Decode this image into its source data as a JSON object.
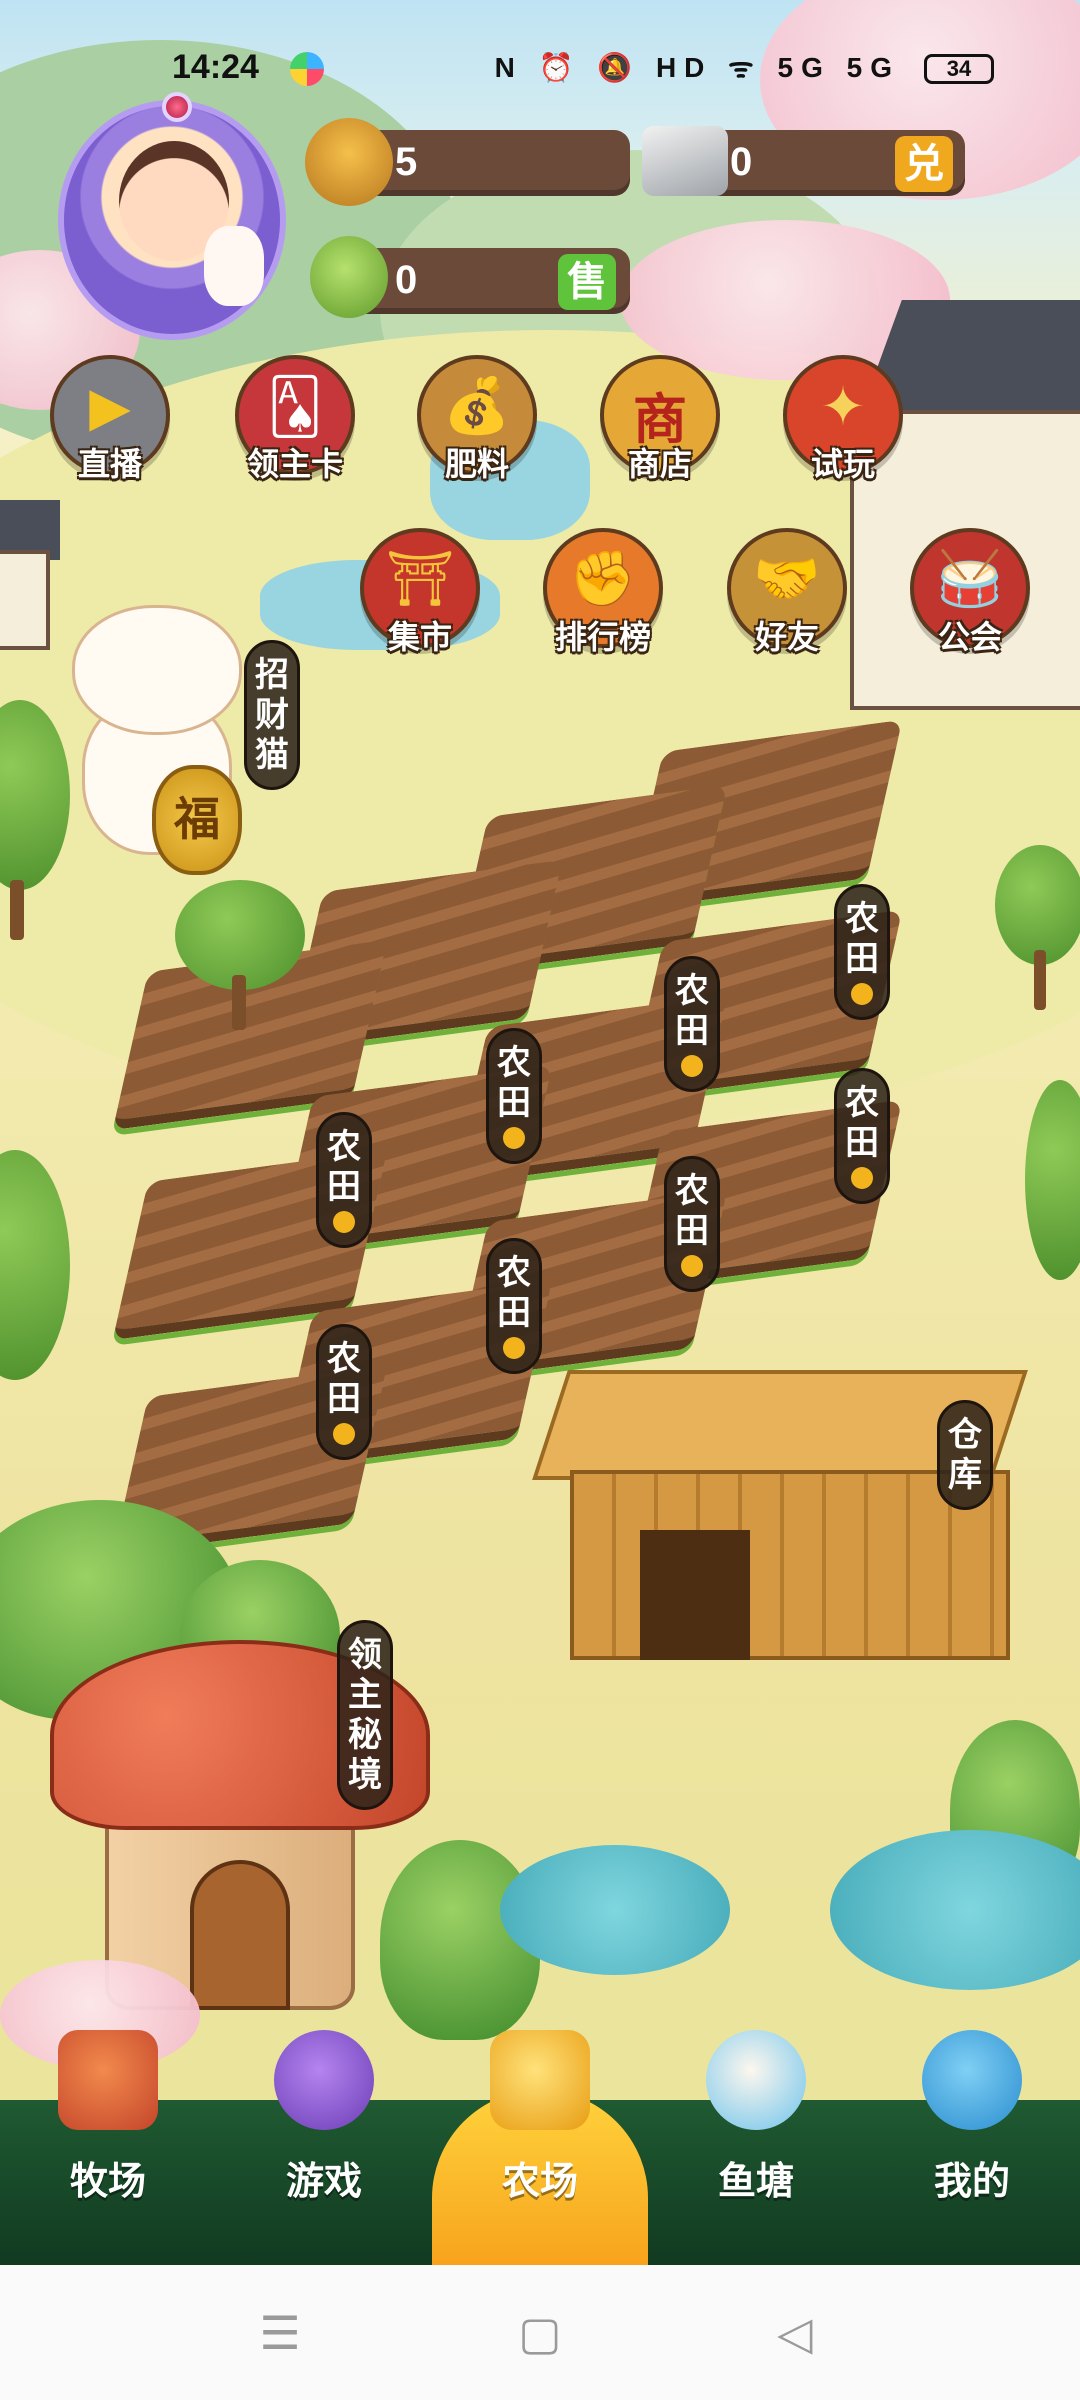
{
  "status_bar": {
    "time": "14:24",
    "icons": "N ⏰ 🔕 HD ᯤ 5G 5G",
    "battery": "34"
  },
  "resources": {
    "grain_count": "5",
    "silver_count": "0",
    "exchange_label": "兑",
    "produce_count": "0",
    "sell_label": "售"
  },
  "menu_row1": [
    {
      "label": "直播",
      "icon": "live-icon",
      "glyph": "▶",
      "color": "#6a6a6a"
    },
    {
      "label": "领主卡",
      "icon": "lord-card-icon",
      "glyph": "🂡",
      "color": "#c6373b"
    },
    {
      "label": "肥料",
      "icon": "fertilizer-icon",
      "glyph": "💰",
      "color": "#c58a3a"
    },
    {
      "label": "商店",
      "icon": "shop-icon",
      "glyph": "商",
      "color": "#d89a32"
    },
    {
      "label": "试玩",
      "icon": "trial-icon",
      "glyph": "✦",
      "color": "#d8452b"
    }
  ],
  "menu_row2": [
    {
      "label": "集市",
      "icon": "market-icon",
      "glyph": "⛩",
      "color": "#c4352b"
    },
    {
      "label": "排行榜",
      "icon": "leaderboard-icon",
      "glyph": "✊",
      "color": "#e67a2a"
    },
    {
      "label": "好友",
      "icon": "friends-icon",
      "glyph": "🤝",
      "color": "#c59238"
    },
    {
      "label": "公会",
      "icon": "guild-icon",
      "glyph": "🥁",
      "color": "#c1352f"
    }
  ],
  "cat_label": "招财猫",
  "cat_coin_text": "福",
  "farmland_label": "农田",
  "warehouse_label": "仓库",
  "lord_realm_label": "领主秘境",
  "bottom_nav": [
    {
      "label": "牧场",
      "icon": "ranch-icon",
      "color": "#d4542d"
    },
    {
      "label": "游戏",
      "icon": "game-icon",
      "color": "#7c4fc9"
    },
    {
      "label": "农场",
      "icon": "farm-icon",
      "color": "#f3b81c"
    },
    {
      "label": "鱼塘",
      "icon": "fishpond-icon",
      "color": "#49b6e6"
    },
    {
      "label": "我的",
      "icon": "profile-icon",
      "color": "#3da7e6"
    }
  ],
  "active_nav": "农场",
  "system_nav": {
    "menu": "☰",
    "home": "▢",
    "back": "◁"
  }
}
